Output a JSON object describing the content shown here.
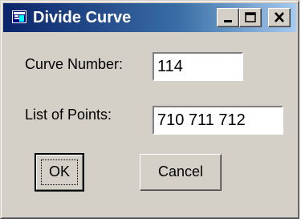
{
  "window": {
    "title": "Divide Curve",
    "icon": "app-icon",
    "buttons": {
      "minimize": "minimize-icon",
      "maximize": "maximize-icon",
      "close": "close-icon"
    }
  },
  "form": {
    "curve_number_label": "Curve Number:",
    "curve_number_value": "114",
    "points_label": "List of Points:",
    "points_value": "710 711 712"
  },
  "actions": {
    "ok_label": "OK",
    "cancel_label": "Cancel"
  },
  "colors": {
    "title_start": "#0a246a",
    "title_end": "#a6caf0",
    "face": "#d4d0c8"
  }
}
